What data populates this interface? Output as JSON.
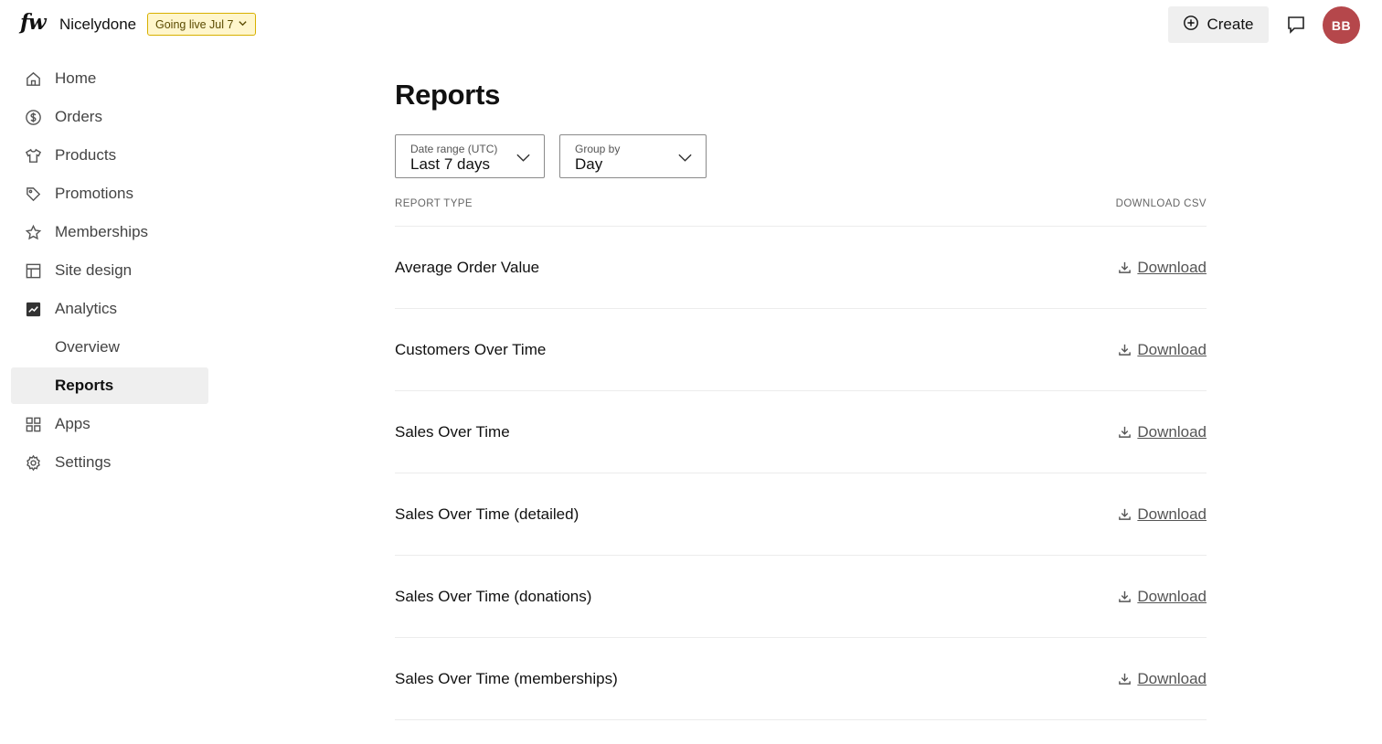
{
  "header": {
    "logo": "fw",
    "store_name": "Nicelydone",
    "going_live": "Going live Jul 7",
    "create_label": "Create",
    "avatar_initials": "BB",
    "avatar_color": "#b5474b"
  },
  "sidebar": {
    "items": [
      {
        "label": "Home",
        "icon": "home-icon"
      },
      {
        "label": "Orders",
        "icon": "dollar-circle-icon"
      },
      {
        "label": "Products",
        "icon": "tshirt-icon"
      },
      {
        "label": "Promotions",
        "icon": "tag-icon"
      },
      {
        "label": "Memberships",
        "icon": "star-icon"
      },
      {
        "label": "Site design",
        "icon": "layout-icon"
      },
      {
        "label": "Analytics",
        "icon": "analytics-icon"
      },
      {
        "label": "Overview"
      },
      {
        "label": "Reports",
        "active": true
      },
      {
        "label": "Apps",
        "icon": "grid-icon"
      },
      {
        "label": "Settings",
        "icon": "gear-icon"
      }
    ]
  },
  "main": {
    "title": "Reports",
    "date_range": {
      "label": "Date range (UTC)",
      "value": "Last 7 days"
    },
    "group_by": {
      "label": "Group by",
      "value": "Day"
    },
    "columns": {
      "type": "REPORT TYPE",
      "download": "DOWNLOAD CSV"
    },
    "rows": [
      {
        "name": "Average Order Value",
        "action": "Download"
      },
      {
        "name": "Customers Over Time",
        "action": "Download"
      },
      {
        "name": "Sales Over Time",
        "action": "Download"
      },
      {
        "name": "Sales Over Time (detailed)",
        "action": "Download"
      },
      {
        "name": "Sales Over Time (donations)",
        "action": "Download"
      },
      {
        "name": "Sales Over Time (memberships)",
        "action": "Download"
      }
    ]
  }
}
